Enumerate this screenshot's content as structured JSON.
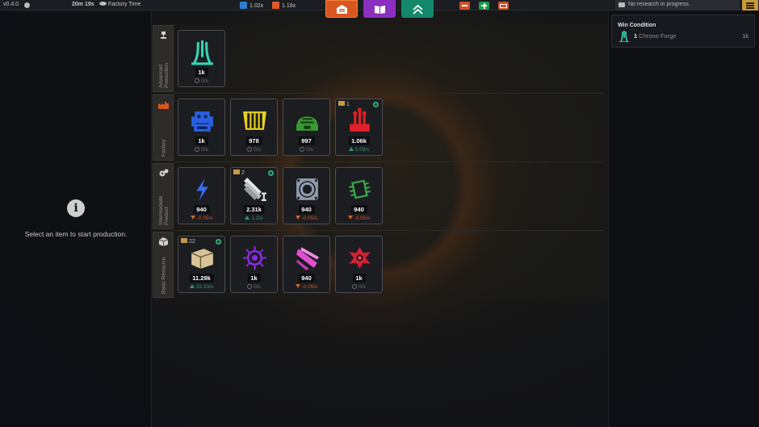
{
  "topbar": {
    "version": "v0.4.0",
    "elapsed": "20m 19s",
    "time_label": "Factory Time",
    "multiplier_blue": "1.02x",
    "multiplier_orange": "1.18x"
  },
  "nav": [
    "factory-nav",
    "research-book-nav",
    "upgrades-nav"
  ],
  "research": {
    "status": "No research in progress."
  },
  "win_condition": {
    "title": "Win Condition",
    "qty": "1",
    "item": "Chrono Forge",
    "value": "1k"
  },
  "left_panel": {
    "message": "Select an item to start production."
  },
  "categories": [
    {
      "name": "Advanced Production",
      "items": [
        {
          "count": "1k",
          "rate": "0/s",
          "trend": "none",
          "icon": "chrono-forge-icon",
          "color": "#39d4b4"
        }
      ]
    },
    {
      "name": "Factory",
      "items": [
        {
          "count": "1k",
          "rate": "0/s",
          "trend": "none",
          "icon": "blue-assembler-icon",
          "color": "#2a5fe0"
        },
        {
          "count": "978",
          "rate": "0/s",
          "trend": "none",
          "icon": "yellow-press-icon",
          "color": "#e9d21e"
        },
        {
          "count": "997",
          "rate": "0/s",
          "trend": "none",
          "icon": "green-dome-icon",
          "color": "#3a9a34"
        },
        {
          "count": "1.06k",
          "rate": "5.09/s",
          "trend": "up",
          "buildings": "1",
          "icon": "red-extractor-icon",
          "color": "#e0202a"
        }
      ]
    },
    {
      "name": "Intermediate Product",
      "items": [
        {
          "count": "940",
          "rate": "-0.05/s",
          "trend": "down",
          "icon": "lightning-icon",
          "color": "#3a6cf0"
        },
        {
          "count": "2.31k",
          "rate": "1.2/s",
          "trend": "up",
          "buildings": "2",
          "icon": "steel-beam-icon",
          "color": "#dcdcdc"
        },
        {
          "count": "940",
          "rate": "-0.05/s",
          "trend": "down",
          "icon": "gear-frame-icon",
          "color": "#9aa8b8"
        },
        {
          "count": "940",
          "rate": "-0.05/s",
          "trend": "down",
          "icon": "circuit-chip-icon",
          "color": "#3aa84a"
        }
      ]
    },
    {
      "name": "Basic Resource",
      "items": [
        {
          "count": "11.29k",
          "rate": "55.33/s",
          "trend": "up",
          "buildings": "22",
          "icon": "crate-icon",
          "color": "#d8c49a"
        },
        {
          "count": "1k",
          "rate": "0/s",
          "trend": "none",
          "icon": "purple-energy-icon",
          "color": "#8a2ae0"
        },
        {
          "count": "940",
          "rate": "-0.05/s",
          "trend": "down",
          "icon": "pink-crystal-icon",
          "color": "#e050d0"
        },
        {
          "count": "1k",
          "rate": "0/s",
          "trend": "none",
          "icon": "red-core-icon",
          "color": "#d42030"
        }
      ]
    }
  ]
}
